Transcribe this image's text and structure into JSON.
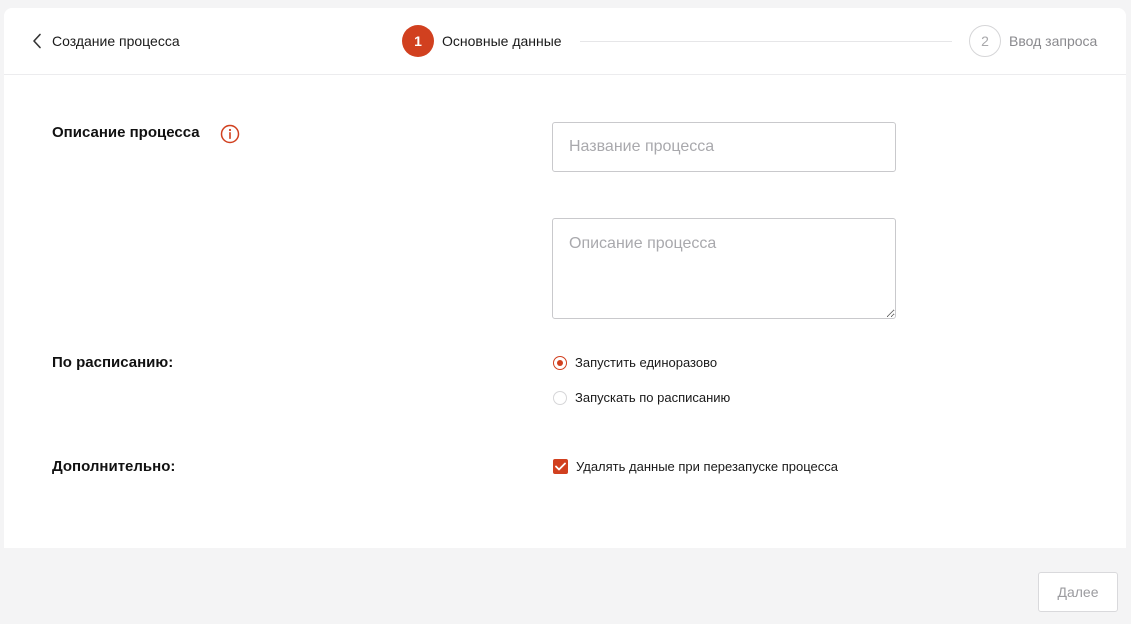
{
  "header": {
    "back_label": "Создание процесса",
    "steps": [
      {
        "number": "1",
        "label": "Основные данные",
        "state": "active"
      },
      {
        "number": "2",
        "label": "Ввод запроса",
        "state": "inactive"
      }
    ]
  },
  "form": {
    "description_section_label": "Описание процесса",
    "name_input": {
      "value": "",
      "placeholder": "Название процесса"
    },
    "description_input": {
      "value": "",
      "placeholder": "Описание процесса"
    },
    "schedule_section_label": "По расписанию:",
    "schedule_options": [
      {
        "label": "Запустить единоразово",
        "selected": true
      },
      {
        "label": "Запускать по расписанию",
        "selected": false
      }
    ],
    "extra_section_label": "Дополнительно:",
    "extra_checkbox": {
      "label": "Удалять данные при перезапуске процесса",
      "checked": true
    }
  },
  "footer": {
    "next_label": "Далее"
  },
  "colors": {
    "accent": "#d1401f",
    "placeholder": "#a9a9ad",
    "border": "#c9c9cc"
  }
}
